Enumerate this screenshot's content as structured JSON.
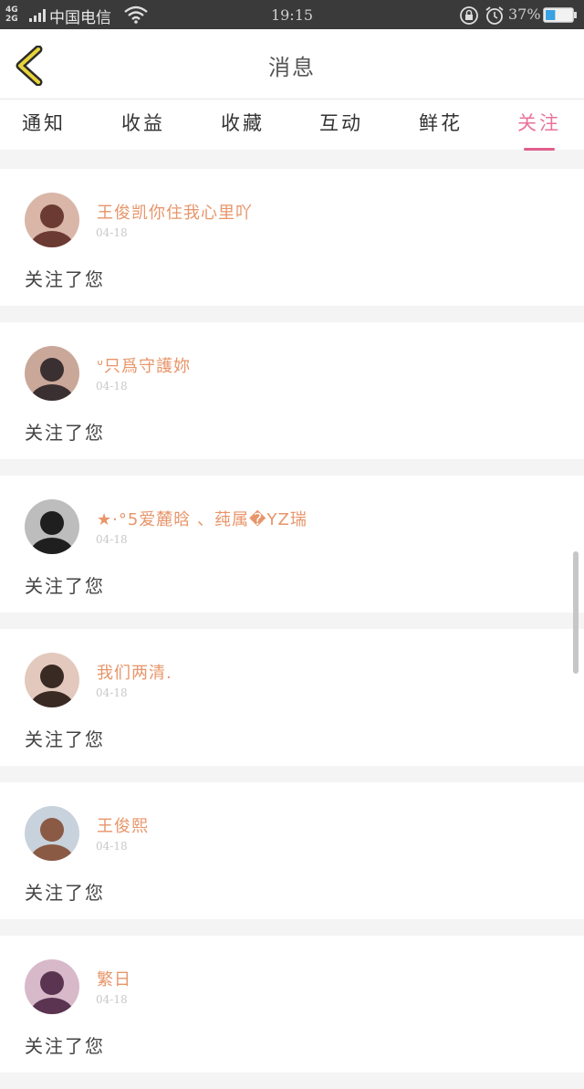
{
  "status_bar": {
    "network_top": "4G",
    "network_bottom": "2G",
    "carrier": "中国电信",
    "time": "19:15",
    "battery_percent": "37%",
    "battery_level": 0.37,
    "icons": [
      "signal-icon",
      "wifi-icon",
      "rotation-lock-icon",
      "alarm-icon",
      "battery-icon"
    ]
  },
  "header": {
    "title": "消息",
    "back_icon": "chevron-left-icon"
  },
  "tabs": [
    {
      "label": "通知",
      "active": false
    },
    {
      "label": "收益",
      "active": false
    },
    {
      "label": "收藏",
      "active": false
    },
    {
      "label": "互动",
      "active": false
    },
    {
      "label": "鲜花",
      "active": false
    },
    {
      "label": "关注",
      "active": true
    }
  ],
  "colors": {
    "accent": "#e05d8c",
    "username": "#e8956a",
    "back_icon": "#e8d43a",
    "status_bar": "#3a3a3a"
  },
  "notifications": [
    {
      "username": "王俊凯你住我心里吖",
      "date": "04-18",
      "message": "关注了您",
      "avatar_colors": [
        "#d9b6a8",
        "#6b3a33"
      ]
    },
    {
      "username": "ᐡ只爲守護妳",
      "date": "04-18",
      "message": "关注了您",
      "avatar_colors": [
        "#c9a89a",
        "#3b3031"
      ]
    },
    {
      "username": "★·°5爱麓晗 、莼属�YZ瑞",
      "date": "04-18",
      "message": "关注了您",
      "avatar_colors": [
        "#bdbdbd",
        "#1f1f1f"
      ]
    },
    {
      "username": "我们两清.",
      "date": "04-18",
      "message": "关注了您",
      "avatar_colors": [
        "#e3c9bd",
        "#3a2a24"
      ]
    },
    {
      "username": "王俊熙",
      "date": "04-18",
      "message": "关注了您",
      "avatar_colors": [
        "#c8d2dc",
        "#8a5a44"
      ]
    },
    {
      "username": "繁日",
      "date": "04-18",
      "message": "关注了您",
      "avatar_colors": [
        "#d8b9c9",
        "#5a3450"
      ]
    }
  ]
}
